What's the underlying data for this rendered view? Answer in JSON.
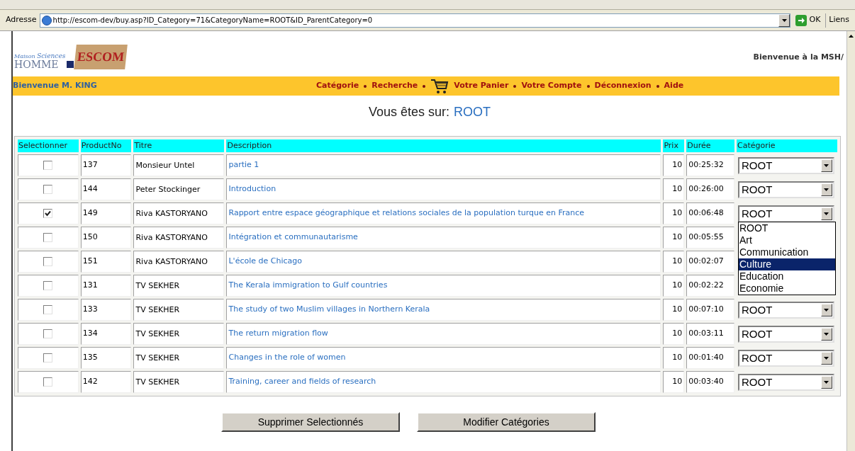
{
  "address_bar": {
    "label": "Adresse",
    "url": "http://escom-dev/buy.asp?ID_Category=71&CategoryName=ROOT&ID_ParentCategory=0",
    "go_button": "OK",
    "links": "Liens"
  },
  "header": {
    "logo": {
      "line_1": "Maison",
      "line_2": "Sciences",
      "line_3": "HOMME",
      "mark": "ESCOM"
    },
    "welcome": "Bienvenue à la MSH/"
  },
  "nav_bar": {
    "user": "Bienvenue M. KING",
    "items": [
      {
        "label": "Catégorie",
        "kind": "link"
      },
      {
        "label": "Recherche",
        "kind": "link"
      },
      {
        "label": "Votre Panier",
        "kind": "cart"
      },
      {
        "label": "Votre Compte",
        "kind": "link"
      },
      {
        "label": "Déconnexion",
        "kind": "link"
      },
      {
        "label": "Aide",
        "kind": "link"
      }
    ]
  },
  "location": {
    "label": "Vous êtes sur:",
    "value": "ROOT"
  },
  "table": {
    "columns": [
      "Selectionner",
      "ProductNo",
      "Titre",
      "Description",
      "Prix",
      "Durée",
      "Catégorie"
    ],
    "rows": [
      {
        "checked": false,
        "product_no": "137",
        "title": "Monsieur Untel",
        "description": "partie 1",
        "price": "10",
        "duration": "00:25:32",
        "category": "ROOT",
        "open": false
      },
      {
        "checked": false,
        "product_no": "144",
        "title": "Peter Stockinger",
        "description": "Introduction",
        "price": "10",
        "duration": "00:26:00",
        "category": "ROOT",
        "open": false
      },
      {
        "checked": true,
        "product_no": "149",
        "title": "Riva KASTORYANO",
        "description": "Rapport entre espace géographique et relations sociales de la population turque en France",
        "price": "10",
        "duration": "00:06:48",
        "category": "ROOT",
        "open": true
      },
      {
        "checked": false,
        "product_no": "150",
        "title": "Riva KASTORYANO",
        "description": "Intégration et communautarisme",
        "price": "10",
        "duration": "00:05:55",
        "open": false
      },
      {
        "checked": false,
        "product_no": "151",
        "title": "Riva KASTORYANO",
        "description": "L'école de Chicago",
        "price": "10",
        "duration": "00:02:07",
        "open": false
      },
      {
        "checked": false,
        "product_no": "131",
        "title": "TV SEKHER",
        "description": "The Kerala immigration to Gulf countries",
        "price": "10",
        "duration": "00:02:22",
        "open": false
      },
      {
        "checked": false,
        "product_no": "133",
        "title": "TV SEKHER",
        "description": "The study of two Muslim villages in Northern Kerala",
        "price": "10",
        "duration": "00:07:10",
        "category": "ROOT",
        "open": false
      },
      {
        "checked": false,
        "product_no": "134",
        "title": "TV SEKHER",
        "description": "The return migration flow",
        "price": "10",
        "duration": "00:03:11",
        "category": "ROOT",
        "open": false
      },
      {
        "checked": false,
        "product_no": "135",
        "title": "TV SEKHER",
        "description": "Changes in the role of women",
        "price": "10",
        "duration": "00:01:40",
        "category": "ROOT",
        "open": false
      },
      {
        "checked": false,
        "product_no": "142",
        "title": "TV SEKHER",
        "description": "Training, career and fields of research",
        "price": "10",
        "duration": "00:03:40",
        "category": "ROOT",
        "open": false
      }
    ]
  },
  "dropdown_options": [
    {
      "label": "ROOT",
      "selected": false
    },
    {
      "label": "Art",
      "selected": false
    },
    {
      "label": "Communication",
      "selected": false
    },
    {
      "label": "Culture",
      "selected": true
    },
    {
      "label": "Education",
      "selected": false
    },
    {
      "label": "Economie",
      "selected": false
    }
  ],
  "buttons": [
    "Supprimer Selectionnés",
    "Modifier Catégories"
  ]
}
